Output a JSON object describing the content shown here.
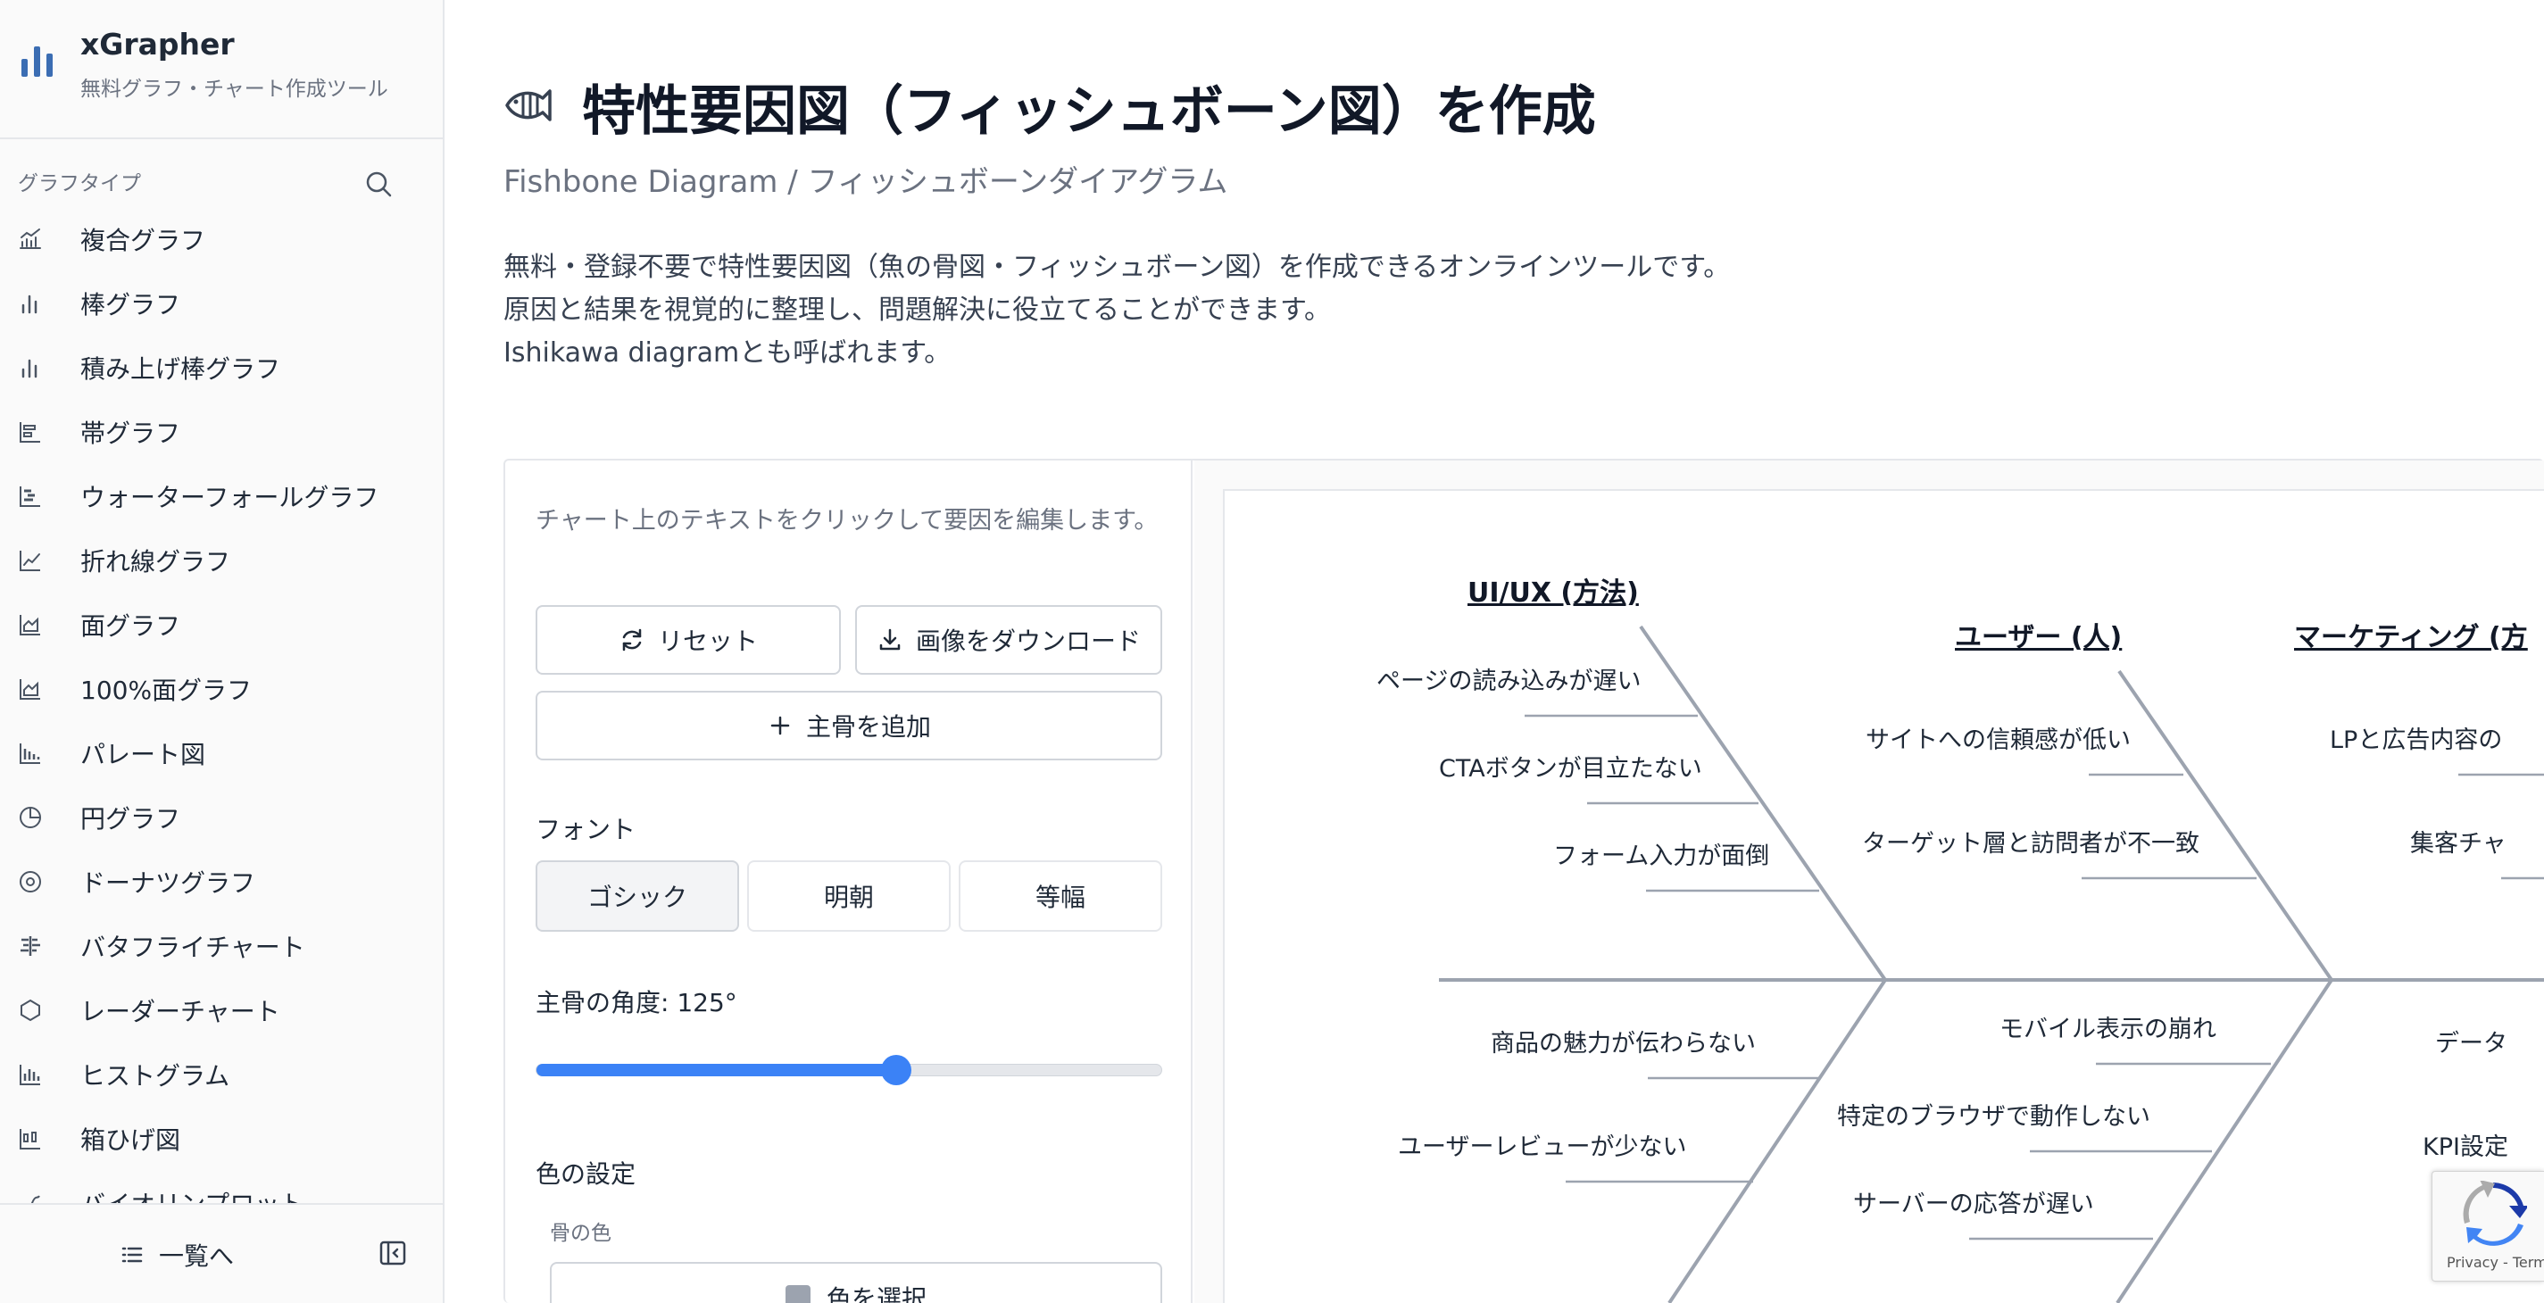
{
  "brand": {
    "title": "xGrapher",
    "subtitle": "無料グラフ・チャート作成ツール"
  },
  "sidebar": {
    "section_label": "グラフタイプ",
    "items": [
      {
        "label": "複合グラフ",
        "icon": "combo-chart-icon"
      },
      {
        "label": "棒グラフ",
        "icon": "bar-chart-icon"
      },
      {
        "label": "積み上げ棒グラフ",
        "icon": "stacked-bar-icon"
      },
      {
        "label": "帯グラフ",
        "icon": "band-chart-icon"
      },
      {
        "label": "ウォーターフォールグラフ",
        "icon": "waterfall-icon"
      },
      {
        "label": "折れ線グラフ",
        "icon": "line-chart-icon"
      },
      {
        "label": "面グラフ",
        "icon": "area-chart-icon"
      },
      {
        "label": "100%面グラフ",
        "icon": "area-100-icon"
      },
      {
        "label": "パレート図",
        "icon": "pareto-icon"
      },
      {
        "label": "円グラフ",
        "icon": "pie-chart-icon"
      },
      {
        "label": "ドーナツグラフ",
        "icon": "donut-chart-icon"
      },
      {
        "label": "バタフライチャート",
        "icon": "butterfly-icon"
      },
      {
        "label": "レーダーチャート",
        "icon": "radar-icon"
      },
      {
        "label": "ヒストグラム",
        "icon": "histogram-icon"
      },
      {
        "label": "箱ひげ図",
        "icon": "boxplot-icon"
      },
      {
        "label": "バイオリンプロット",
        "icon": "violin-icon"
      }
    ],
    "footer_label": "一覧へ"
  },
  "header": {
    "title": "特性要因図（フィッシュボーン図）を作成",
    "subtitle": "Fishbone Diagram / フィッシュボーンダイアグラム",
    "desc1": "無料・登録不要で特性要因図（魚の骨図・フィッシュボーン図）を作成できるオンラインツールです。",
    "desc2": "原因と結果を視覚的に整理し、問題解決に役立てることができます。",
    "desc3": "Ishikawa diagramとも呼ばれます。"
  },
  "controls": {
    "hint": "チャート上のテキストをクリックして要因を編集します。",
    "reset_label": "リセット",
    "download_label": "画像をダウンロード",
    "add_bone_label": "主骨を追加",
    "font_label": "フォント",
    "font_options": [
      "ゴシック",
      "明朝",
      "等幅"
    ],
    "font_selected": "ゴシック",
    "angle_label": "主骨の角度: 125°",
    "angle_value": 125,
    "angle_fraction": 0.575,
    "color_section_label": "色の設定",
    "bone_color_label": "骨の色",
    "bone_color_button": "色を選択",
    "bone_color": "#9ca3af"
  },
  "diagram": {
    "bone_color": "#9ca3af",
    "categories": {
      "uiux": "UI/UX (方法)",
      "user": "ユーザー (人)",
      "marketing": "マーケティング (方"
    },
    "causes": {
      "uiux_1": "ページの読み込みが遅い",
      "uiux_2": "CTAボタンが目立たない",
      "uiux_3": "フォーム入力が面倒",
      "user_1": "サイトへの信頼感が低い",
      "user_2": "ターゲット層と訪問者が不一致",
      "mkt_1": "LPと広告内容の",
      "mkt_2": "集客チャ",
      "low1_1": "商品の魅力が伝わらない",
      "low1_2": "ユーザーレビューが少ない",
      "low2_1": "モバイル表示の崩れ",
      "low2_2": "特定のブラウザで動作しない",
      "low2_3": "サーバーの応答が遅い",
      "low3_1": "データ",
      "low3_2": "KPI設定"
    }
  },
  "recaptcha": {
    "text": "Privacy - Terms"
  }
}
